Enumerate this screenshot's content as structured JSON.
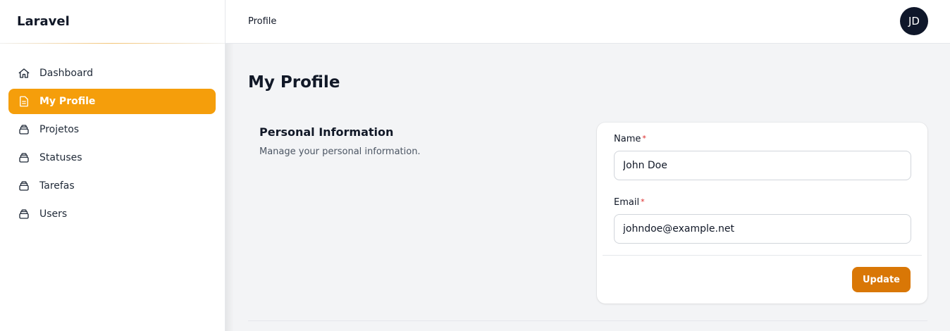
{
  "app": {
    "brand": "Laravel"
  },
  "sidebar": {
    "items": [
      {
        "label": "Dashboard",
        "icon": "home-icon",
        "active": false
      },
      {
        "label": "My Profile",
        "icon": "document-icon",
        "active": true
      },
      {
        "label": "Projetos",
        "icon": "collection-icon",
        "active": false
      },
      {
        "label": "Statuses",
        "icon": "collection-icon",
        "active": false
      },
      {
        "label": "Tarefas",
        "icon": "collection-icon",
        "active": false
      },
      {
        "label": "Users",
        "icon": "collection-icon",
        "active": false
      }
    ]
  },
  "header": {
    "breadcrumb": "Profile",
    "avatar_initials": "JD"
  },
  "main": {
    "title": "My Profile",
    "section": {
      "title": "Personal Information",
      "description": "Manage your personal information."
    },
    "form": {
      "name_label": "Name",
      "name_value": "John Doe",
      "email_label": "Email",
      "email_value": "johndoe@example.net",
      "required_marker": "*",
      "submit_label": "Update"
    }
  },
  "colors": {
    "accent": "#f59e0b",
    "button": "#d97706",
    "avatar_bg": "#0f172a",
    "required": "#dc2626"
  }
}
